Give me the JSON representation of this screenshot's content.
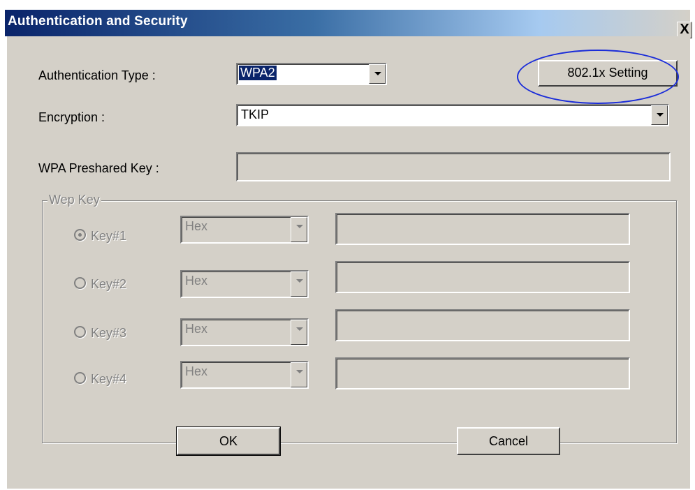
{
  "window": {
    "title": "Authentication and Security",
    "close_label": "X"
  },
  "authentication": {
    "label": "Authentication Type :",
    "value": "WPA2",
    "setting_button": "802.1x Setting"
  },
  "encryption": {
    "label": "Encryption :",
    "value": "TKIP"
  },
  "preshared": {
    "label": "WPA Preshared Key :",
    "value": ""
  },
  "wep": {
    "group_label": "Wep Key",
    "keys": [
      {
        "label": "Key#1",
        "format": "Hex",
        "selected": true,
        "value": ""
      },
      {
        "label": "Key#2",
        "format": "Hex",
        "selected": false,
        "value": ""
      },
      {
        "label": "Key#3",
        "format": "Hex",
        "selected": false,
        "value": ""
      },
      {
        "label": "Key#4",
        "format": "Hex",
        "selected": false,
        "value": ""
      }
    ]
  },
  "buttons": {
    "ok": "OK",
    "cancel": "Cancel"
  },
  "annotation": {
    "color": "#1a2cd9"
  }
}
